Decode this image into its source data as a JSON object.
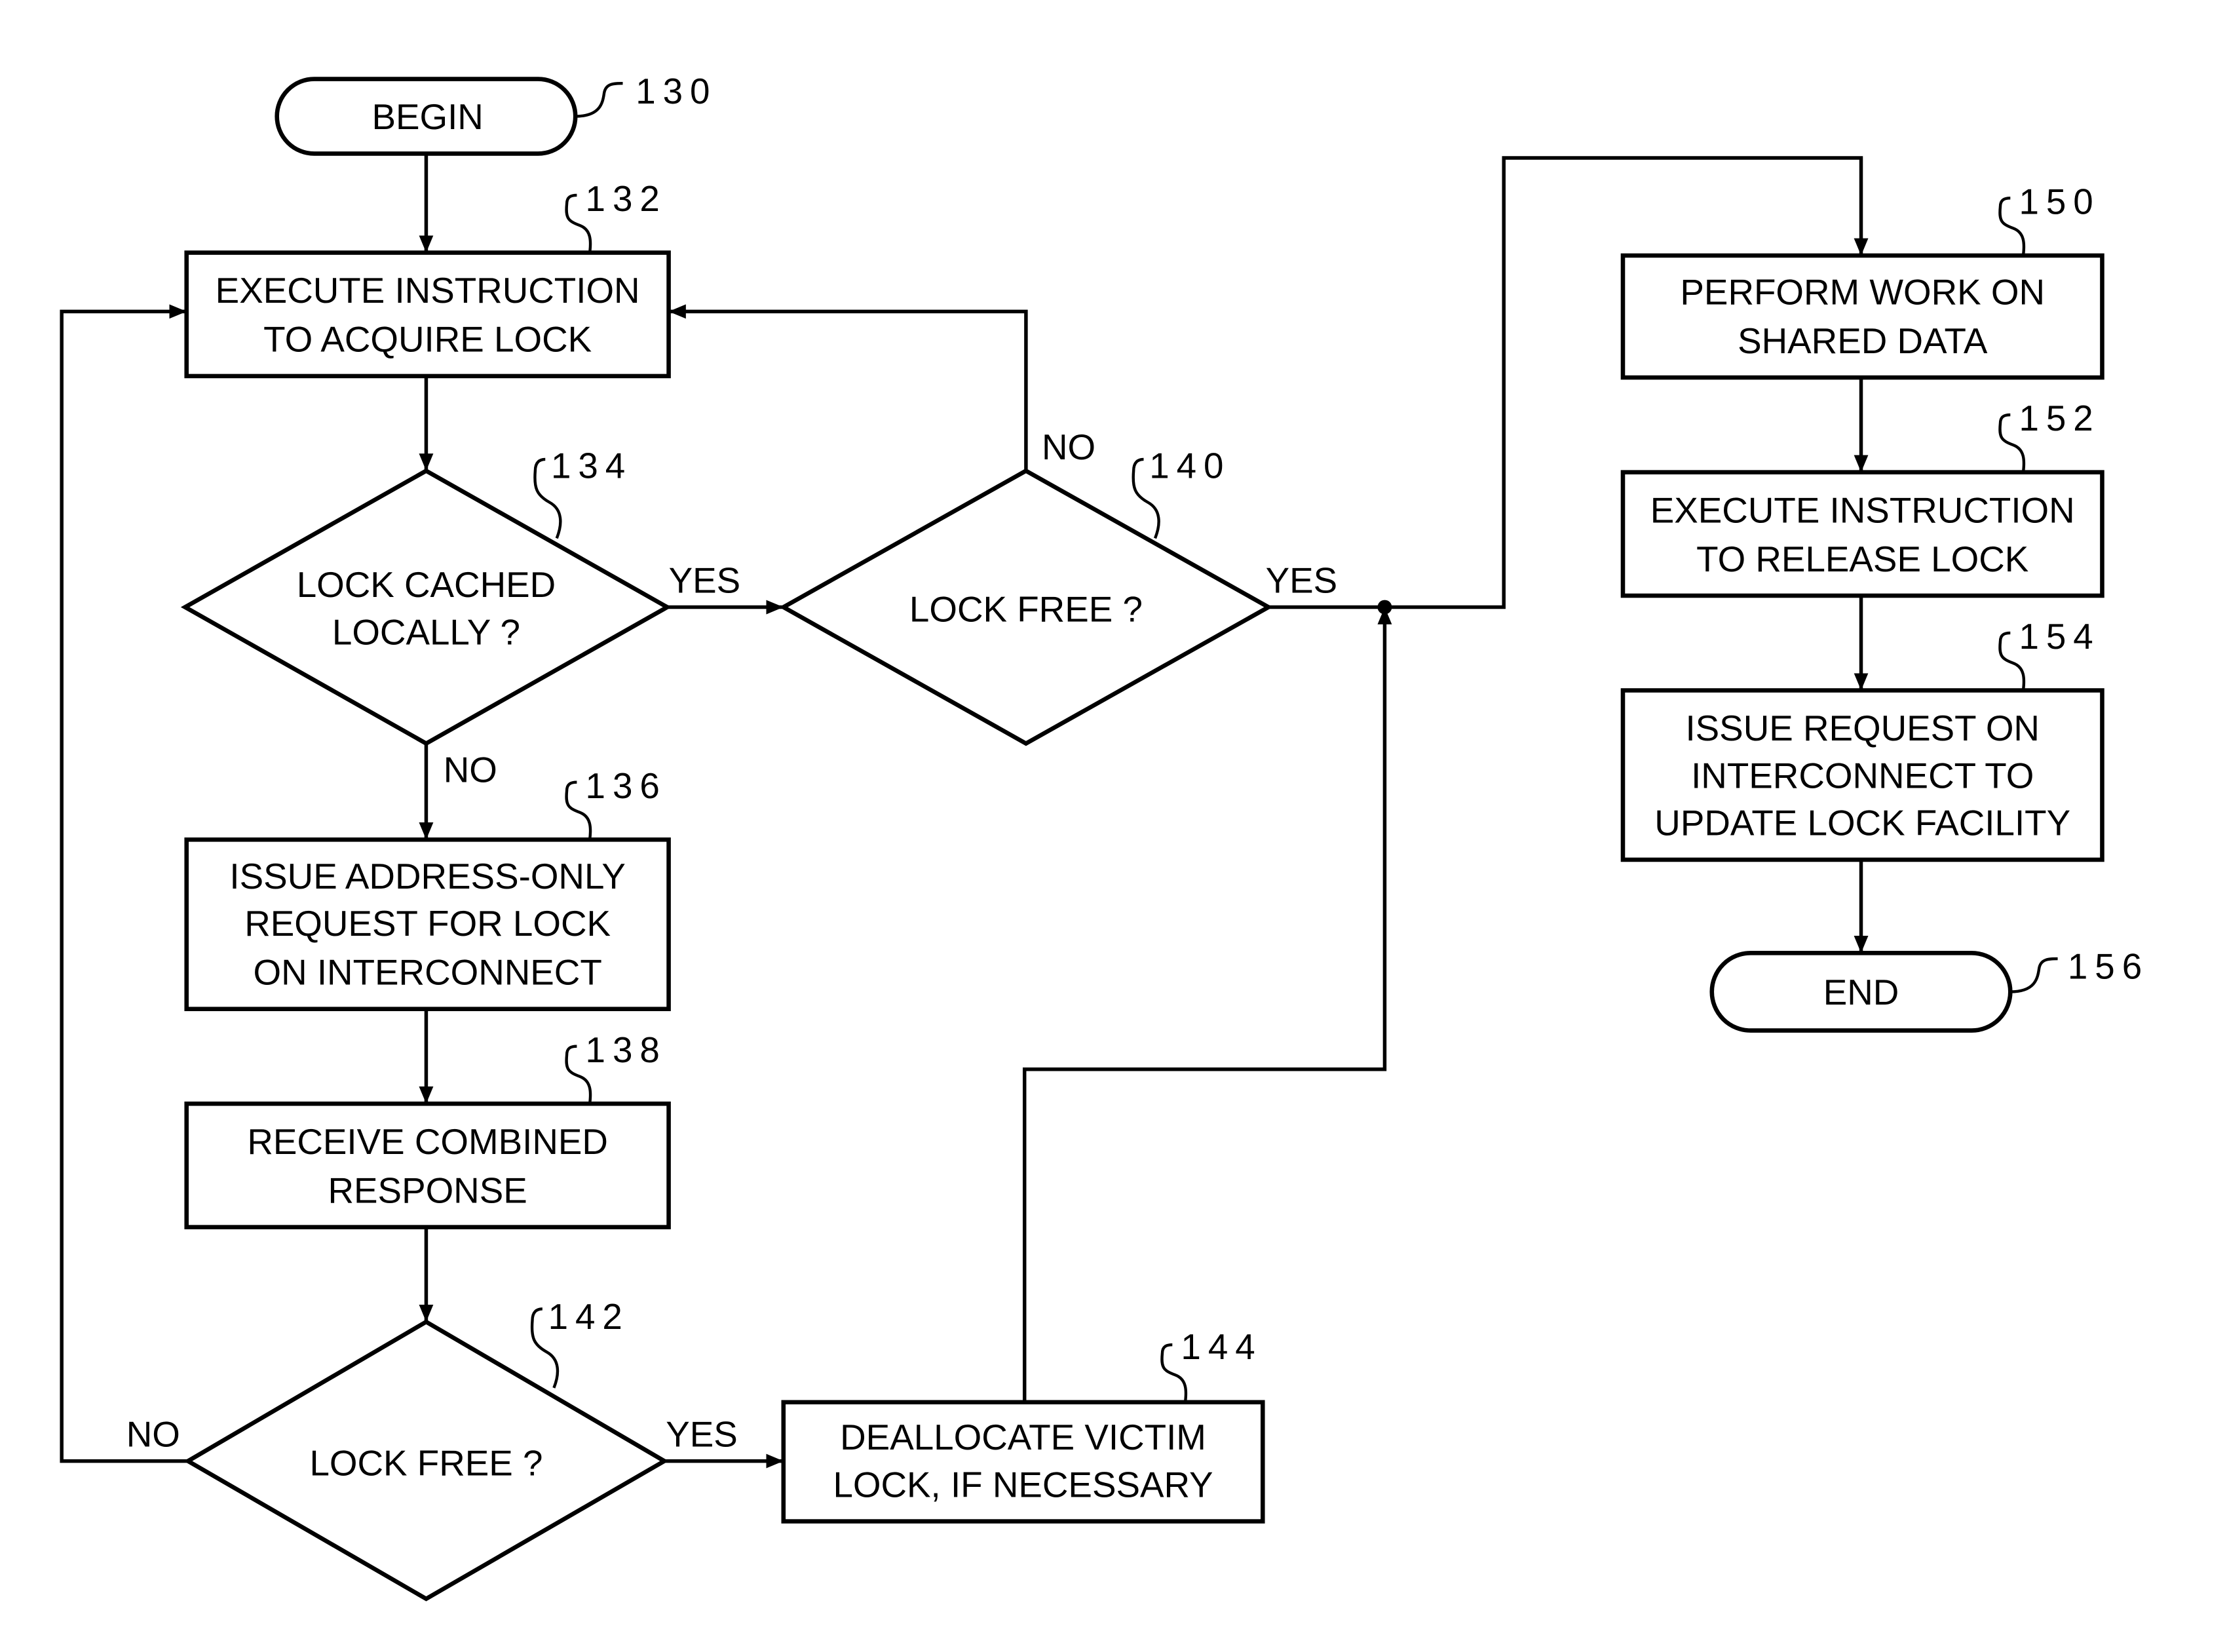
{
  "figure": {
    "nodes": {
      "begin": {
        "ref": "130",
        "lines": [
          "BEGIN"
        ]
      },
      "acquire": {
        "ref": "132",
        "lines": [
          "EXECUTE INSTRUCTION",
          "TO ACQUIRE LOCK"
        ]
      },
      "cached": {
        "ref": "134",
        "lines": [
          "LOCK CACHED",
          "LOCALLY ?"
        ]
      },
      "issue_addr": {
        "ref": "136",
        "lines": [
          "ISSUE ADDRESS-ONLY",
          "REQUEST FOR LOCK",
          "ON INTERCONNECT"
        ]
      },
      "receive": {
        "ref": "138",
        "lines": [
          "RECEIVE COMBINED",
          "RESPONSE"
        ]
      },
      "free_local": {
        "ref": "140",
        "lines": [
          "LOCK FREE ?"
        ]
      },
      "free_remote": {
        "ref": "142",
        "lines": [
          "LOCK FREE ?"
        ]
      },
      "dealloc": {
        "ref": "144",
        "lines": [
          "DEALLOCATE VICTIM",
          "LOCK, IF NECESSARY"
        ]
      },
      "work": {
        "ref": "150",
        "lines": [
          "PERFORM WORK ON",
          "SHARED DATA"
        ]
      },
      "release": {
        "ref": "152",
        "lines": [
          "EXECUTE INSTRUCTION",
          "TO RELEASE LOCK"
        ]
      },
      "update": {
        "ref": "154",
        "lines": [
          "ISSUE REQUEST ON",
          "INTERCONNECT TO",
          "UPDATE LOCK FACILITY"
        ]
      },
      "end": {
        "ref": "156",
        "lines": [
          "END"
        ]
      }
    },
    "edge_labels": {
      "cached_yes": "YES",
      "cached_no": "NO",
      "free_local_no": "NO",
      "free_local_yes": "YES",
      "free_remote_no": "NO",
      "free_remote_yes": "YES"
    }
  }
}
